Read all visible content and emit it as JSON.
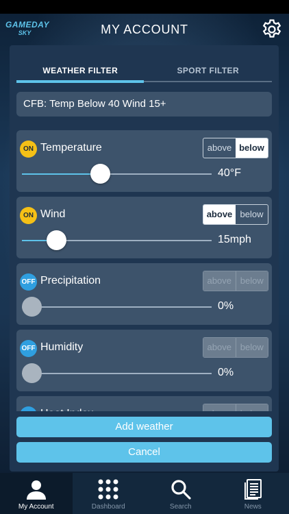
{
  "app": {
    "logo_line1": "GAMEDAY",
    "logo_line2": "SKY",
    "title": "MY ACCOUNT"
  },
  "tabs": [
    {
      "label": "WEATHER FILTER",
      "active": true
    },
    {
      "label": "SPORT FILTER",
      "active": false
    }
  ],
  "preset": "CFB: Temp Below 40 Wind 15+",
  "toggle_labels": {
    "above": "above",
    "below": "below"
  },
  "filters": [
    {
      "badge": "ON",
      "label": "Temperature",
      "mode": "below",
      "value": "40°F",
      "level": 0.41,
      "enabled": true
    },
    {
      "badge": "ON",
      "label": "Wind",
      "mode": "above",
      "value": "15mph",
      "level": 0.18,
      "enabled": true
    },
    {
      "badge": "OFF",
      "label": "Precipitation",
      "mode": "none",
      "value": "0%",
      "level": 0.0,
      "enabled": false
    },
    {
      "badge": "OFF",
      "label": "Humidity",
      "mode": "none",
      "value": "0%",
      "level": 0.0,
      "enabled": false
    },
    {
      "badge": "OFF",
      "label": "Heat Index",
      "mode": "none",
      "value": "",
      "level": 0.0,
      "enabled": false
    }
  ],
  "buttons": {
    "add": "Add weather",
    "cancel": "Cancel"
  },
  "nav": [
    {
      "label": "My Account",
      "icon": "person-icon",
      "active": true
    },
    {
      "label": "Dashboard",
      "icon": "grid-dots-icon",
      "active": false
    },
    {
      "label": "Search",
      "icon": "search-icon",
      "active": false
    },
    {
      "label": "News",
      "icon": "newspaper-icon",
      "active": false
    }
  ],
  "colors": {
    "accent": "#5ec3ea",
    "on_badge": "#f5c016",
    "off_badge": "#2f9fe0",
    "card": "#3d536b",
    "panel": "#1f3651"
  }
}
